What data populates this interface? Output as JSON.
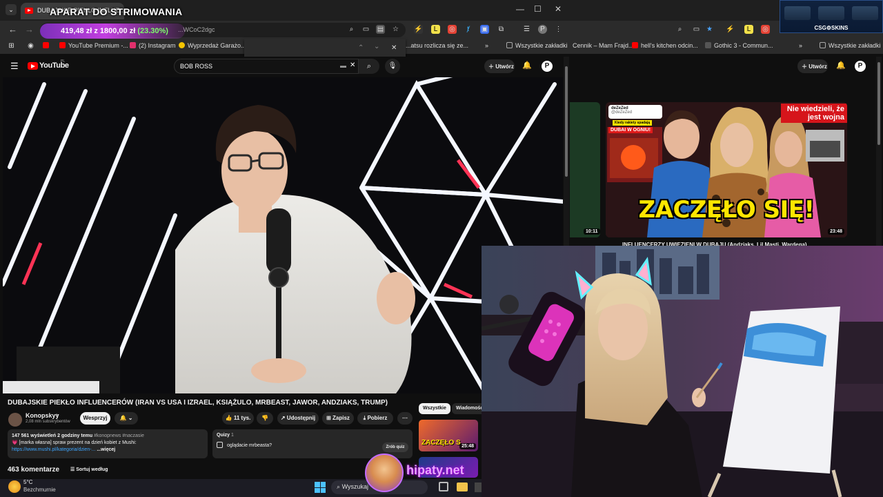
{
  "left_browser": {
    "tab_title": "DUBAJSKIE PIEKŁO INFLUE...",
    "stream_title": "APARAT DO STRIMOWANIA",
    "donation_goal": {
      "text": "419,48 zł z 1800,00 zł",
      "percent": "(23.30%)"
    },
    "url": "...WCoC2dgc",
    "bookmarks": [
      {
        "label": "YouTube Premium -...",
        "color": "#ff0000"
      },
      {
        "label": "(2) Instagram",
        "color": "#e1306c"
      },
      {
        "label": "Wyprzedaż Garażo...",
        "color": "#f5c400"
      },
      {
        "label": "...atsu rozlicza się ze...",
        "color": "#888888"
      },
      {
        "label": "Wszystkie zakładki",
        "color": "#aaaaaa"
      }
    ],
    "find_bar": {
      "up": "⌃",
      "down": "⌄",
      "close": "✕"
    },
    "youtube": {
      "logo": "YouTube",
      "logo_sup": "PL",
      "search_value": "BOB ROSS",
      "create_label": "Utwórz",
      "avatar_letter": "P"
    },
    "video": {
      "title": "DUBAJSKIE PIEKŁO INFLUENCERÓW (IRAN VS USA I IZRAEL, KSIĄŻULO, MRBEAST, JAWOR, ANDZIAKS, TRUMP)",
      "channel": "Konopskyy",
      "subscribers": "2,08 mln subskrybentów",
      "support_label": "Wesprzyj",
      "likes": "11 tys.",
      "share_label": "Udostępnij",
      "save_label": "Zapisz",
      "download_label": "Pobierz",
      "views_line": "147 561 wyświetleń  2 godziny temu",
      "hashtags": "#konopnews #naczasie",
      "promo_line": "💗 [marka własna] spraw prezent na dzień kobiet z Mushi:",
      "promo_link": "https://www.mushi.pl/kategoria/dzien-...",
      "more_label": "...więcej",
      "quiz_header": "Quizy",
      "quiz_count": "1",
      "quiz_question": "oglądacie mrbeasta?",
      "quiz_button": "Zrób quiz",
      "comments_count": "463 komentarze",
      "sort_label": "Sortuj według"
    },
    "related": {
      "chips": [
        "Wszystkie",
        "Wiadomości"
      ],
      "thumb_text": "ZACZĘŁO S",
      "thumb_duration": "25:48"
    }
  },
  "right_browser": {
    "bookmarks": [
      {
        "label": "Cennik – Mam Frajd...",
        "color": "#888888"
      },
      {
        "label": "hell's kitchen odcin...",
        "color": "#ff0000"
      },
      {
        "label": "Gothic 3 - Commun...",
        "color": "#888888"
      },
      {
        "label": "Wszystkie zakładki",
        "color": "#aaaaaa"
      }
    ],
    "create_label": "Utwórz",
    "avatar_letter": "P",
    "csgo_label": "CSG⚙SKINS",
    "thumb_left_duration": "10:11",
    "thumb": {
      "channel": "deZeZed",
      "handle": "@deZeZed",
      "sticker1": "Kiedy rakiety spadają",
      "sticker2": "DUBAI W OGNIU!",
      "headline_top": "Nie wiedzieli, że jest wojna",
      "big_text": "ZACZĘŁO SIĘ!",
      "duration": "23:48"
    },
    "video_title": "INFLUENCERZY UWIĘZIENI W DUBAJU (Andziaks, Lil Masti, Wardęga)"
  },
  "taskbar": {
    "temperature": "5°C",
    "weather": "Bezchmurnie",
    "search_placeholder": "Wyszukaj"
  },
  "watermark": "hipaty.net"
}
